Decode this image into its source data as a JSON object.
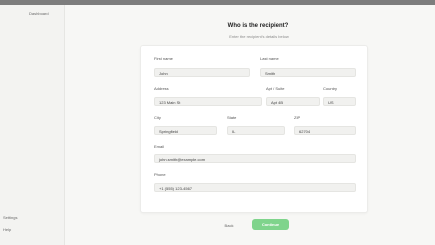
{
  "sidebar": {
    "nav_item": "Dashboard",
    "footer_items": [
      "Settings",
      "Help"
    ]
  },
  "header": {
    "title": "Who is the recipient?",
    "subtitle": "Enter the recipient's details below"
  },
  "form": {
    "first_name": {
      "label": "First name",
      "value": "John"
    },
    "last_name": {
      "label": "Last name",
      "value": "Smith"
    },
    "address": {
      "label": "Address",
      "value": "123 Main St"
    },
    "apt": {
      "label": "Apt / Suite",
      "value": "Apt 4B"
    },
    "country": {
      "label": "Country",
      "value": "US"
    },
    "city": {
      "label": "City",
      "value": "Springfield"
    },
    "state": {
      "label": "State",
      "value": "IL"
    },
    "zip": {
      "label": "ZIP",
      "value": "62704"
    },
    "email": {
      "label": "Email",
      "value": "john.smith@example.com"
    },
    "phone": {
      "label": "Phone",
      "value": "+1 (555) 123-4567"
    }
  },
  "footer": {
    "back_label": "Back",
    "next_label": "Continue"
  },
  "colors": {
    "accent": "#7fd48c",
    "background": "#f7f7f5",
    "topbar": "#7d7d7d"
  }
}
